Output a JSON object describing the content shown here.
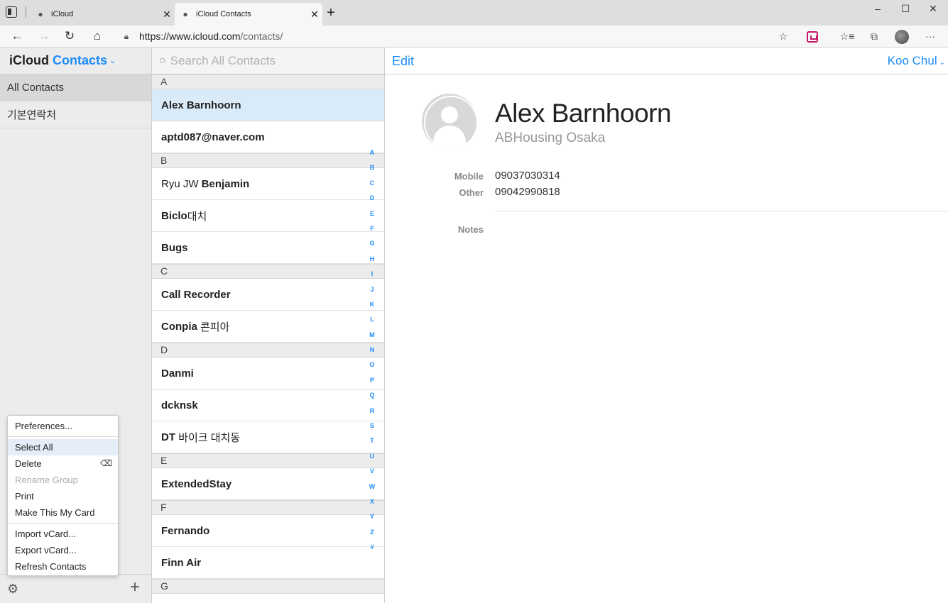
{
  "browser": {
    "tabs": [
      {
        "label": "iCloud",
        "icon": "apple-icon"
      },
      {
        "label": "iCloud Contacts",
        "icon": "apple-icon"
      }
    ],
    "url_host": "https://www.icloud.com",
    "url_path": "/contacts/",
    "window_controls": {
      "minimize": "–",
      "maximize": "☐",
      "close": "✕"
    }
  },
  "app": {
    "title_prefix": "iCloud",
    "title_app": "Contacts",
    "groups": [
      "All Contacts",
      "기본연락처"
    ],
    "search_placeholder": "Search All Contacts",
    "edit_label": "Edit",
    "account_label": "Koo Chul"
  },
  "contacts": {
    "sections": [
      {
        "letter": "A",
        "rows": [
          {
            "bold": "Alex Barnhoorn",
            "light": ""
          },
          {
            "bold": "aptd087@naver.com",
            "light": ""
          }
        ]
      },
      {
        "letter": "B",
        "rows": [
          {
            "light_prefix": "Ryu JW ",
            "bold": "Benjamin"
          },
          {
            "bold": "Biclo",
            "light": "대치"
          },
          {
            "bold": "Bugs",
            "light": ""
          }
        ]
      },
      {
        "letter": "C",
        "rows": [
          {
            "bold": "Call Recorder",
            "light": ""
          },
          {
            "bold": "Conpia",
            "light": " 콘피아"
          }
        ]
      },
      {
        "letter": "D",
        "rows": [
          {
            "bold": "Danmi",
            "light": ""
          },
          {
            "bold": "dcknsk",
            "light": ""
          },
          {
            "bold": "DT",
            "light": " 바이크 대치동"
          }
        ]
      },
      {
        "letter": "E",
        "rows": [
          {
            "bold": "ExtendedStay",
            "light": ""
          }
        ]
      },
      {
        "letter": "F",
        "rows": [
          {
            "bold": "Fernando",
            "light": ""
          },
          {
            "bold": "Finn Air",
            "light": ""
          }
        ]
      },
      {
        "letter": "G",
        "rows": []
      }
    ],
    "index_letters": [
      "A",
      "B",
      "C",
      "D",
      "E",
      "F",
      "G",
      "H",
      "I",
      "J",
      "K",
      "L",
      "M",
      "N",
      "O",
      "P",
      "Q",
      "R",
      "S",
      "T",
      "U",
      "V",
      "W",
      "X",
      "Y",
      "Z",
      "#"
    ]
  },
  "detail": {
    "name": "Alex Barnhoorn",
    "company": "ABHousing Osaka",
    "fields": [
      {
        "label": "Mobile",
        "value": "09037030314"
      },
      {
        "label": "Other",
        "value": "09042990818"
      }
    ],
    "notes_label": "Notes"
  },
  "menu": {
    "items": [
      {
        "label": "Preferences...",
        "state": "normal"
      },
      {
        "label": "Select All",
        "state": "highlighted"
      },
      {
        "label": "Delete",
        "state": "normal",
        "shortcut": "⌫"
      },
      {
        "label": "Rename Group",
        "state": "disabled"
      },
      {
        "label": "Print",
        "state": "normal"
      },
      {
        "label": "Make This My Card",
        "state": "normal"
      },
      {
        "label": "Import vCard...",
        "state": "normal"
      },
      {
        "label": "Export vCard...",
        "state": "normal"
      },
      {
        "label": "Refresh Contacts",
        "state": "normal"
      }
    ]
  },
  "colors": {
    "accent": "#1d8cf8",
    "selected_row": "#d9eaf8",
    "sidebar_bg": "#ececec"
  }
}
